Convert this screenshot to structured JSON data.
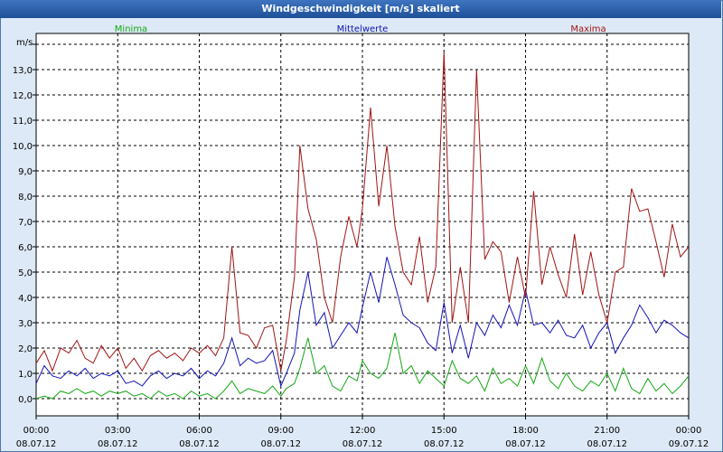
{
  "window": {
    "title": "Windgeschwindigkeit [m/s] skaliert"
  },
  "colors": {
    "minima": "#14a814",
    "mittelwerte": "#1414b4",
    "maxima": "#a01414",
    "grid": "#000000",
    "plot_bg": "#ffffff"
  },
  "chart_data": {
    "type": "line",
    "title": "Windgeschwindigkeit [m/s] skaliert",
    "ylabel": "m/s",
    "xlabel": "",
    "ylim": [
      -0.4,
      14.5
    ],
    "xlim": [
      0,
      24
    ],
    "grid": true,
    "legend_placement": "top",
    "y_ticks": [
      "0,0",
      "1,0",
      "2,0",
      "3,0",
      "4,0",
      "5,0",
      "6,0",
      "7,0",
      "8,0",
      "9,0",
      "10,0",
      "11,0",
      "12,0",
      "13,0"
    ],
    "x_ticks": [
      {
        "time": "00:00",
        "date": "08.07.12"
      },
      {
        "time": "03:00",
        "date": "08.07.12"
      },
      {
        "time": "06:00",
        "date": "08.07.12"
      },
      {
        "time": "09:00",
        "date": "08.07.12"
      },
      {
        "time": "12:00",
        "date": "08.07.12"
      },
      {
        "time": "15:00",
        "date": "08.07.12"
      },
      {
        "time": "18:00",
        "date": "08.07.12"
      },
      {
        "time": "21:00",
        "date": "08.07.12"
      },
      {
        "time": "00:00",
        "date": "09.07.12"
      }
    ],
    "series": [
      {
        "name": "Minima",
        "x": [
          0,
          0.3,
          0.6,
          0.9,
          1.2,
          1.5,
          1.8,
          2.1,
          2.4,
          2.7,
          3.0,
          3.3,
          3.6,
          3.9,
          4.2,
          4.5,
          4.8,
          5.1,
          5.4,
          5.7,
          6.0,
          6.3,
          6.6,
          6.9,
          7.2,
          7.5,
          7.8,
          8.1,
          8.4,
          8.7,
          9.0,
          9.2,
          9.5,
          9.7,
          10.0,
          10.3,
          10.6,
          10.9,
          11.2,
          11.5,
          11.8,
          12.0,
          12.3,
          12.6,
          12.9,
          13.2,
          13.5,
          13.8,
          14.1,
          14.4,
          14.7,
          15.0,
          15.3,
          15.6,
          15.9,
          16.2,
          16.5,
          16.8,
          17.1,
          17.4,
          17.7,
          18.0,
          18.3,
          18.6,
          18.9,
          19.2,
          19.5,
          19.8,
          20.1,
          20.4,
          20.7,
          21.0,
          21.3,
          21.6,
          21.9,
          22.2,
          22.5,
          22.8,
          23.1,
          23.4,
          23.7,
          24.0
        ],
        "values": [
          0.0,
          0.1,
          0.0,
          0.3,
          0.2,
          0.4,
          0.2,
          0.3,
          0.1,
          0.3,
          0.2,
          0.3,
          0.1,
          0.2,
          0.0,
          0.3,
          0.1,
          0.2,
          0.0,
          0.3,
          0.1,
          0.2,
          0.0,
          0.3,
          0.7,
          0.2,
          0.4,
          0.3,
          0.2,
          0.5,
          0.1,
          0.4,
          0.6,
          1.2,
          2.4,
          1.0,
          1.3,
          0.5,
          0.3,
          0.9,
          0.7,
          1.5,
          1.0,
          0.8,
          1.2,
          2.6,
          1.0,
          1.3,
          0.6,
          1.1,
          0.8,
          0.5,
          1.5,
          0.8,
          0.6,
          0.9,
          0.3,
          1.2,
          0.6,
          0.8,
          0.5,
          1.3,
          0.6,
          1.6,
          0.7,
          0.4,
          1.0,
          0.5,
          0.3,
          0.7,
          0.5,
          1.0,
          0.3,
          1.2,
          0.4,
          0.2,
          0.8,
          0.3,
          0.6,
          0.2,
          0.5,
          0.9
        ]
      },
      {
        "name": "Mittelwerte",
        "x": [
          0,
          0.3,
          0.6,
          0.9,
          1.2,
          1.5,
          1.8,
          2.1,
          2.4,
          2.7,
          3.0,
          3.3,
          3.6,
          3.9,
          4.2,
          4.5,
          4.8,
          5.1,
          5.4,
          5.7,
          6.0,
          6.3,
          6.6,
          6.9,
          7.2,
          7.5,
          7.8,
          8.1,
          8.4,
          8.7,
          9.0,
          9.2,
          9.5,
          9.7,
          10.0,
          10.3,
          10.6,
          10.9,
          11.2,
          11.5,
          11.8,
          12.0,
          12.3,
          12.6,
          12.9,
          13.2,
          13.5,
          13.8,
          14.1,
          14.4,
          14.7,
          15.0,
          15.3,
          15.6,
          15.9,
          16.2,
          16.5,
          16.8,
          17.1,
          17.4,
          17.7,
          18.0,
          18.3,
          18.6,
          18.9,
          19.2,
          19.5,
          19.8,
          20.1,
          20.4,
          20.7,
          21.0,
          21.3,
          21.6,
          21.9,
          22.2,
          22.5,
          22.8,
          23.1,
          23.4,
          23.7,
          24.0
        ],
        "values": [
          0.6,
          1.3,
          0.9,
          0.8,
          1.1,
          0.9,
          1.2,
          0.8,
          1.0,
          0.9,
          1.1,
          0.6,
          0.7,
          0.5,
          0.9,
          1.1,
          0.8,
          1.0,
          0.9,
          1.2,
          0.8,
          1.1,
          0.9,
          1.4,
          2.4,
          1.3,
          1.6,
          1.4,
          1.5,
          1.9,
          0.5,
          1.0,
          1.8,
          3.5,
          5.0,
          2.9,
          3.4,
          2.0,
          2.5,
          3.0,
          2.6,
          3.6,
          5.0,
          3.8,
          5.6,
          4.5,
          3.3,
          3.0,
          2.8,
          2.2,
          1.9,
          3.8,
          1.8,
          2.9,
          1.6,
          3.0,
          2.5,
          3.3,
          2.8,
          3.7,
          2.9,
          4.3,
          2.9,
          3.0,
          2.6,
          3.1,
          2.5,
          2.4,
          2.9,
          2.0,
          2.6,
          3.0,
          1.8,
          2.4,
          2.9,
          3.7,
          3.2,
          2.6,
          3.1,
          2.9,
          2.6,
          2.4
        ]
      },
      {
        "name": "Maxima",
        "x": [
          0,
          0.3,
          0.6,
          0.9,
          1.2,
          1.5,
          1.8,
          2.1,
          2.4,
          2.7,
          3.0,
          3.3,
          3.6,
          3.9,
          4.2,
          4.5,
          4.8,
          5.1,
          5.4,
          5.7,
          6.0,
          6.3,
          6.6,
          6.9,
          7.2,
          7.5,
          7.8,
          8.1,
          8.4,
          8.7,
          9.0,
          9.2,
          9.5,
          9.7,
          10.0,
          10.3,
          10.6,
          10.9,
          11.2,
          11.5,
          11.8,
          12.0,
          12.3,
          12.6,
          12.9,
          13.2,
          13.5,
          13.8,
          14.1,
          14.4,
          14.7,
          15.0,
          15.3,
          15.6,
          15.9,
          16.2,
          16.5,
          16.8,
          17.1,
          17.4,
          17.7,
          18.0,
          18.3,
          18.6,
          18.9,
          19.2,
          19.5,
          19.8,
          20.1,
          20.4,
          20.7,
          21.0,
          21.3,
          21.6,
          21.9,
          22.2,
          22.5,
          22.8,
          23.1,
          23.4,
          23.7,
          24.0
        ],
        "values": [
          1.4,
          1.9,
          1.1,
          2.0,
          1.8,
          2.3,
          1.6,
          1.4,
          2.1,
          1.6,
          2.0,
          1.2,
          1.6,
          1.1,
          1.7,
          1.9,
          1.6,
          1.8,
          1.5,
          2.0,
          1.8,
          2.1,
          1.7,
          2.4,
          6.0,
          2.6,
          2.5,
          2.0,
          2.8,
          2.9,
          1.1,
          2.3,
          4.8,
          10.0,
          7.5,
          6.3,
          4.0,
          3.0,
          5.6,
          7.2,
          6.0,
          7.5,
          11.5,
          7.6,
          10.0,
          6.8,
          5.0,
          4.5,
          6.4,
          3.8,
          5.2,
          13.7,
          3.0,
          5.2,
          3.0,
          13.0,
          5.5,
          6.2,
          5.8,
          3.8,
          5.6,
          4.0,
          8.2,
          4.5,
          6.0,
          4.9,
          4.0,
          6.5,
          4.1,
          5.8,
          4.1,
          3.0,
          5.0,
          5.2,
          8.3,
          7.4,
          7.5,
          6.2,
          4.8,
          6.9,
          5.6,
          6.0
        ]
      }
    ]
  }
}
